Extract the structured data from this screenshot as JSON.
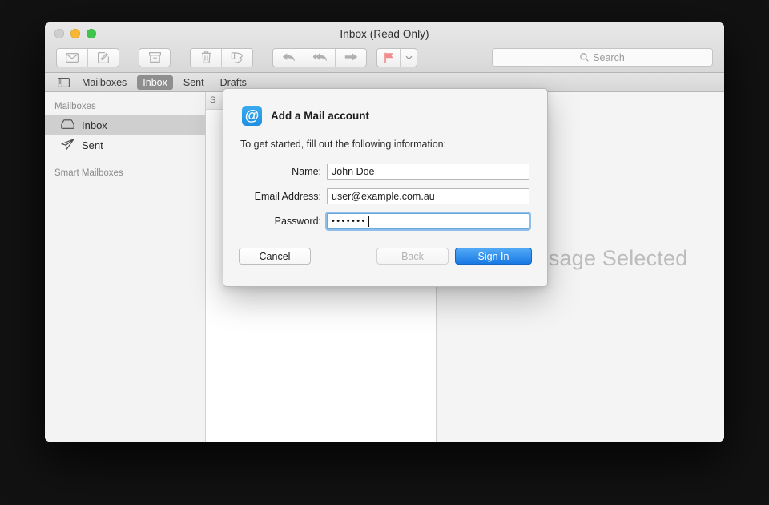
{
  "window": {
    "title": "Inbox (Read Only)",
    "traffic_lights": [
      "close-button",
      "minimize-button",
      "zoom-button"
    ]
  },
  "toolbar": {
    "groups": [
      {
        "buttons": [
          {
            "name": "get-mail-button",
            "icon": "envelope-icon"
          },
          {
            "name": "compose-button",
            "icon": "compose-icon"
          }
        ]
      },
      {
        "buttons": [
          {
            "name": "archive-button",
            "icon": "archive-box-icon"
          }
        ]
      },
      {
        "buttons": [
          {
            "name": "delete-button",
            "icon": "trash-icon"
          },
          {
            "name": "junk-button",
            "icon": "thumbs-down-icon"
          }
        ]
      },
      {
        "buttons": [
          {
            "name": "reply-button",
            "icon": "reply-arrow-icon"
          },
          {
            "name": "reply-all-button",
            "icon": "reply-all-arrow-icon"
          },
          {
            "name": "forward-button",
            "icon": "forward-arrow-icon"
          }
        ]
      },
      {
        "buttons": [
          {
            "name": "flag-button",
            "icon": "flag-icon"
          },
          {
            "name": "flag-dropdown-button",
            "icon": "chevron-down-icon"
          }
        ]
      }
    ],
    "flag_color": "#f28b8b"
  },
  "search": {
    "placeholder": "Search",
    "value": "",
    "icon": "search-icon"
  },
  "favorites_bar": {
    "toggle_icon": "sidebar-toggle-icon",
    "items": [
      {
        "label": "Mailboxes",
        "selected": false
      },
      {
        "label": "Inbox",
        "selected": true
      },
      {
        "label": "Sent",
        "selected": false
      },
      {
        "label": "Drafts",
        "selected": false
      }
    ]
  },
  "sidebar": {
    "section_one": "Mailboxes",
    "section_two": "Smart Mailboxes",
    "items": [
      {
        "label": "Inbox",
        "icon": "inbox-tray-icon",
        "selected": true
      },
      {
        "label": "Sent",
        "icon": "paper-plane-icon",
        "selected": false
      }
    ]
  },
  "message_list": {
    "sort_header": "S"
  },
  "content": {
    "empty_state": "No Message Selected"
  },
  "dialog": {
    "icon": "at-sign-icon",
    "title": "Add a Mail account",
    "subtitle": "To get started, fill out the following information:",
    "fields": [
      {
        "label": "Name:",
        "value": "John Doe",
        "focused": false
      },
      {
        "label": "Email Address:",
        "value": "user@example.com.au",
        "focused": false
      },
      {
        "label": "Password:",
        "value": "•••••••",
        "focused": true
      }
    ],
    "buttons": {
      "cancel": "Cancel",
      "back": "Back",
      "sign_in": "Sign In"
    },
    "accent_color": "#1879e4"
  }
}
